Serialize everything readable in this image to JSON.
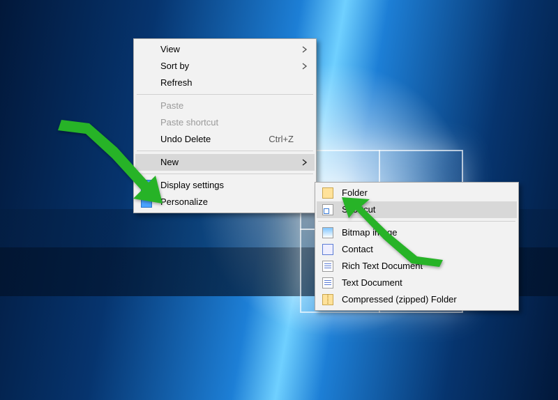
{
  "mainMenu": {
    "view": {
      "label": "View",
      "hasSub": true
    },
    "sort": {
      "label": "Sort by",
      "hasSub": true
    },
    "refresh": {
      "label": "Refresh"
    },
    "paste": {
      "label": "Paste",
      "disabled": true
    },
    "pasteShort": {
      "label": "Paste shortcut",
      "disabled": true
    },
    "undo": {
      "label": "Undo Delete",
      "shortcut": "Ctrl+Z"
    },
    "new": {
      "label": "New",
      "hasSub": true,
      "highlighted": true
    },
    "display": {
      "label": "Display settings"
    },
    "personalize": {
      "label": "Personalize"
    }
  },
  "subMenu": {
    "folder": {
      "label": "Folder"
    },
    "shortcut": {
      "label": "Shortcut",
      "highlighted": true
    },
    "bmp": {
      "label": "Bitmap image"
    },
    "contact": {
      "label": "Contact"
    },
    "rtf": {
      "label": "Rich Text Document"
    },
    "txt": {
      "label": "Text Document"
    },
    "zip": {
      "label": "Compressed (zipped) Folder"
    }
  }
}
